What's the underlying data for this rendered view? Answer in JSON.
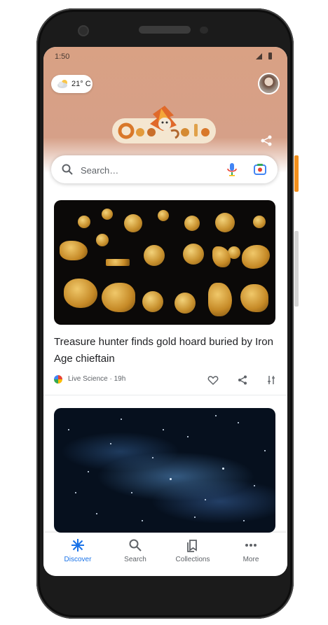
{
  "status_bar": {
    "time": "1:50"
  },
  "header": {
    "weather": {
      "temperature": "21° C",
      "icon": "partly-cloudy-icon"
    },
    "doodle_text": "Google",
    "share_icon": "share-icon"
  },
  "search": {
    "placeholder": "Search…"
  },
  "feed": [
    {
      "title": "Treasure hunter finds gold hoard buried by Iron Age chieftain",
      "source": "Live Science",
      "age": "19h",
      "meta": "Live Science · 19h"
    }
  ],
  "bottom_nav": [
    {
      "label": "Discover",
      "icon": "discover-icon",
      "active": true
    },
    {
      "label": "Search",
      "icon": "search-icon",
      "active": false
    },
    {
      "label": "Collections",
      "icon": "collections-icon",
      "active": false
    },
    {
      "label": "More",
      "icon": "more-icon",
      "active": false
    }
  ],
  "colors": {
    "accent": "#1a73e8",
    "header": "#d6a088"
  }
}
